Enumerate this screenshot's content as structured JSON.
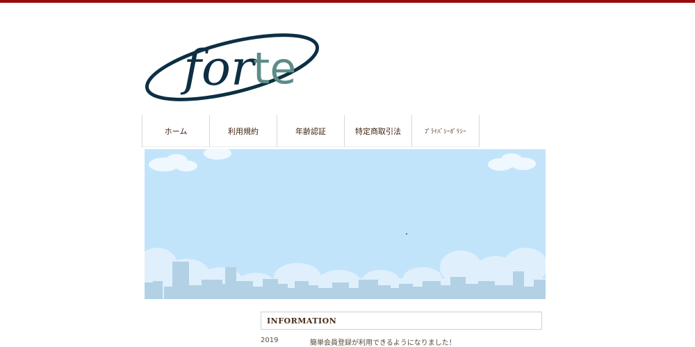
{
  "logo": {
    "text_for": "for",
    "text_te": "te",
    "color_dark": "#0d2f44",
    "color_accent": "#5d8c89"
  },
  "nav": {
    "items": [
      {
        "label": "ホーム"
      },
      {
        "label": "利用規約"
      },
      {
        "label": "年齢認証"
      },
      {
        "label": "特定商取引法"
      },
      {
        "label": "ﾌﾟﾗｲﾊﾞｼｰﾎﾟﾘｼｰ"
      }
    ]
  },
  "information": {
    "heading": "INFORMATION",
    "items": [
      {
        "year": "2019",
        "text": "簡単会員登録が利用できるようになりました！"
      }
    ]
  },
  "colors": {
    "top_bar": "#9a0a0a",
    "sky": "#c2e4fb",
    "buildings": "#b3d1e4"
  }
}
